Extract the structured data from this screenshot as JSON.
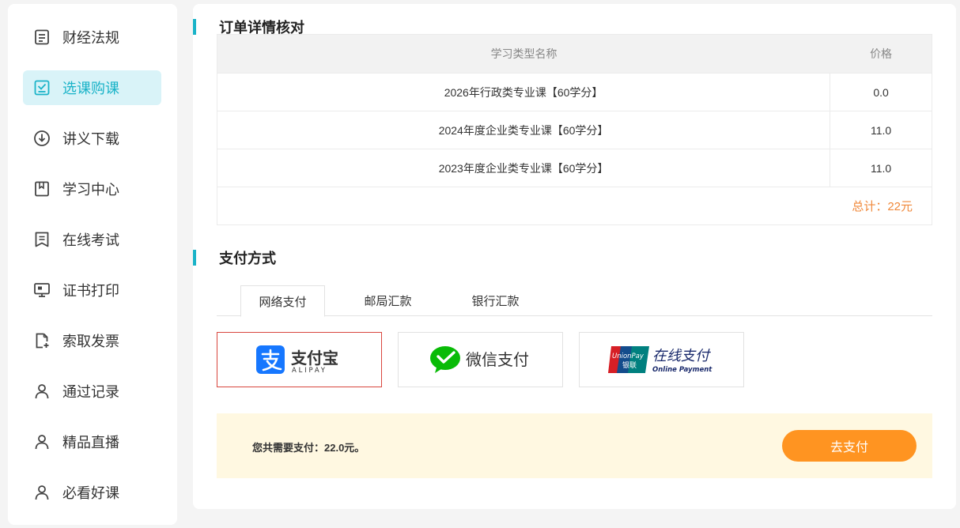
{
  "sidebar": {
    "items": [
      {
        "label": "财经法规",
        "icon": "document-icon"
      },
      {
        "label": "选课购课",
        "icon": "checkbox-icon"
      },
      {
        "label": "讲义下载",
        "icon": "download-icon"
      },
      {
        "label": "学习中心",
        "icon": "bookmark-icon"
      },
      {
        "label": "在线考试",
        "icon": "exam-icon"
      },
      {
        "label": "证书打印",
        "icon": "monitor-icon"
      },
      {
        "label": "索取发票",
        "icon": "invoice-icon"
      },
      {
        "label": "通过记录",
        "icon": "user-icon"
      },
      {
        "label": "精品直播",
        "icon": "user-icon"
      },
      {
        "label": "必看好课",
        "icon": "user-icon"
      }
    ],
    "active_index": 1
  },
  "order": {
    "title": "订单详情核对",
    "columns": [
      "学习类型名称",
      "价格"
    ],
    "rows": [
      {
        "name": "2026年行政类专业课【60学分】",
        "price": "0.0"
      },
      {
        "name": "2024年度企业类专业课【60学分】",
        "price": "11.0"
      },
      {
        "name": "2023年度企业类专业课【60学分】",
        "price": "11.0"
      }
    ],
    "total": "总计：22元"
  },
  "payment": {
    "title": "支付方式",
    "tabs": [
      "网络支付",
      "邮局汇款",
      "银行汇款"
    ],
    "active_tab": 0,
    "methods": {
      "alipay": {
        "name": "支付宝",
        "sub": "ALIPAY"
      },
      "wechat": {
        "name": "微信支付"
      },
      "unionpay": {
        "name": "在线支付",
        "sub": "Online Payment",
        "logo_top": "UnionPay",
        "logo_bottom": "银联"
      }
    },
    "selected_method": "alipay"
  },
  "summary": {
    "text": "您共需要支付：22.0元。",
    "button": "去支付"
  },
  "colors": {
    "accent": "#1ab3c8",
    "active_bg": "#d9f3f8",
    "total": "#f0883a",
    "pay_button": "#ff9421",
    "selected_border": "#d9463e",
    "summary_bg": "#fff8e1",
    "alipay_blue": "#1677ff",
    "wechat_green": "#09bb07"
  }
}
